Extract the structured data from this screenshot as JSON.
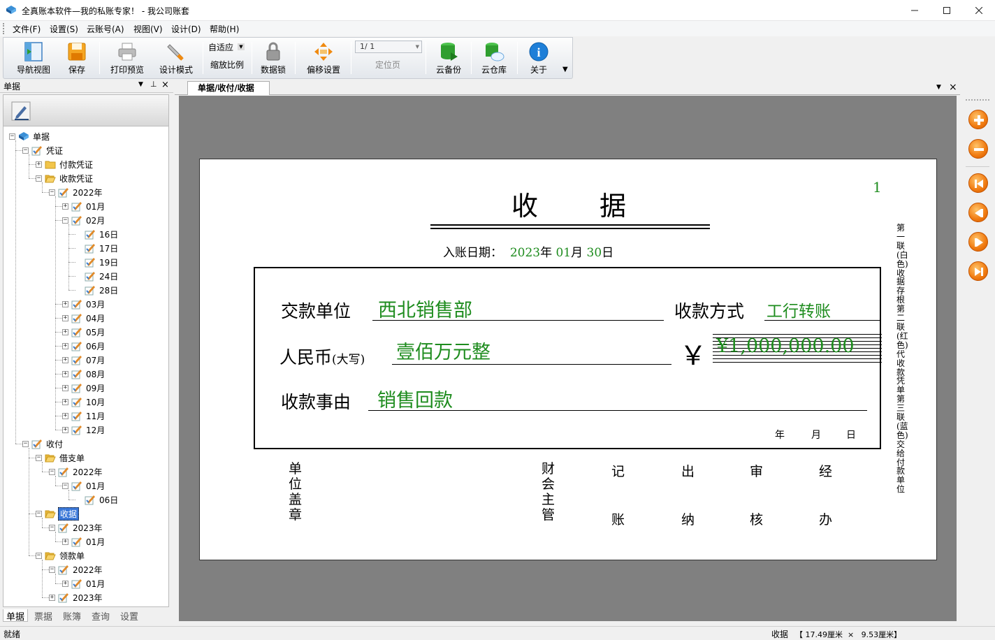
{
  "window": {
    "title": "全真账本软件—我的私账专家！ - 我公司账套"
  },
  "menu": [
    "文件(F)",
    "设置(S)",
    "云账号(A)",
    "视图(V)",
    "设计(D)",
    "帮助(H)"
  ],
  "toolbar": {
    "nav": "导航视图",
    "save": "保存",
    "print": "打印预览",
    "design": "设计模式",
    "zoom_value": "自适应",
    "zoom_label": "缩放比例",
    "lock": "数据锁",
    "offset": "偏移设置",
    "page_value": "1/  1",
    "page_label": "定位页",
    "backup": "云备份",
    "cloud": "云仓库",
    "about": "关于"
  },
  "left_panel": {
    "title": "单据",
    "tree": [
      {
        "label": "单据"
      },
      {
        "label": "凭证"
      },
      {
        "label": "付款凭证"
      },
      {
        "label": "收款凭证"
      },
      {
        "label": "2022年"
      },
      {
        "label": "01月"
      },
      {
        "label": "02月"
      },
      {
        "label": "16日"
      },
      {
        "label": "17日"
      },
      {
        "label": "19日"
      },
      {
        "label": "24日"
      },
      {
        "label": "28日"
      },
      {
        "label": "03月"
      },
      {
        "label": "04月"
      },
      {
        "label": "05月"
      },
      {
        "label": "06月"
      },
      {
        "label": "07月"
      },
      {
        "label": "08月"
      },
      {
        "label": "09月"
      },
      {
        "label": "10月"
      },
      {
        "label": "11月"
      },
      {
        "label": "12月"
      },
      {
        "label": "收付"
      },
      {
        "label": "借支单"
      },
      {
        "label": "2022年"
      },
      {
        "label": "01月"
      },
      {
        "label": "06日"
      },
      {
        "label": "收据"
      },
      {
        "label": "2023年"
      },
      {
        "label": "01月"
      },
      {
        "label": "领款单"
      },
      {
        "label": "2022年"
      },
      {
        "label": "01月"
      },
      {
        "label": "2023年"
      }
    ],
    "tabs": [
      "单据",
      "票据",
      "账簿",
      "查询",
      "设置"
    ]
  },
  "document": {
    "tab_label": "单据/收付/收据",
    "page_number": "1",
    "title": "收　　据",
    "date_label": "入账日期：",
    "date_year": "2023",
    "year_unit": "年",
    "date_month": "01",
    "month_unit": "月",
    "date_day": "30",
    "day_unit": "日",
    "payer_label": "交款单位",
    "payer_value": "西北销售部",
    "method_label": "收款方式",
    "method_value": "工行转账",
    "rmb_label": "人民币",
    "rmb_sub": "(大写)",
    "amount_words": "壹佰万元整",
    "yen_symbol": "￥",
    "amount": "¥1,000,000.00",
    "reason_label": "收款事由",
    "reason_value": "销售回款",
    "footer_year": "年",
    "footer_month": "月",
    "footer_day": "日",
    "stamp_label": "单位盖章",
    "accountant_label": "财会主管",
    "signers": [
      [
        "记",
        "账"
      ],
      [
        "出",
        "纳"
      ],
      [
        "审",
        "核"
      ],
      [
        "经",
        "办"
      ]
    ],
    "side_note": "第一联(白色)：收据存根　第二联(红色)：代收款凭单　第三联(蓝色)：交给付款单位"
  },
  "status": {
    "left": "就绪",
    "doc": "收据",
    "size": "【 17.49厘米  ×   9.53厘米】"
  },
  "colors": {
    "green_text": "#1e8c1e",
    "canvas": "#808080",
    "accent": "#3b78d8"
  }
}
